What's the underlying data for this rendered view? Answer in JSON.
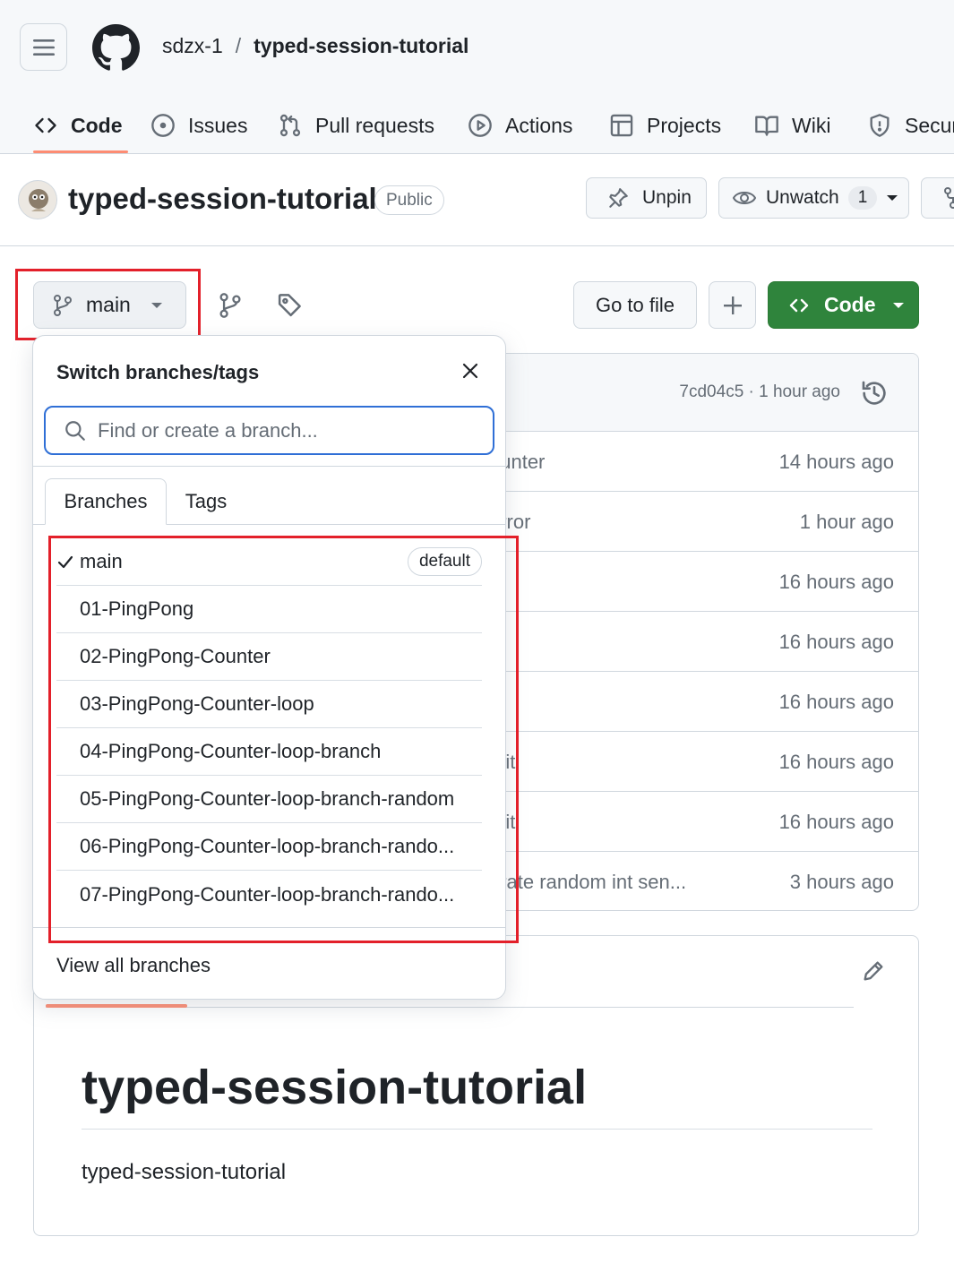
{
  "header": {
    "owner": "sdzx-1",
    "separator": "/",
    "repo": "typed-session-tutorial"
  },
  "nav_tabs": [
    {
      "label": "Code",
      "icon": "code-icon",
      "active": true
    },
    {
      "label": "Issues",
      "icon": "issue-opened-icon"
    },
    {
      "label": "Pull requests",
      "icon": "git-pull-request-icon"
    },
    {
      "label": "Actions",
      "icon": "play-icon"
    },
    {
      "label": "Projects",
      "icon": "table-icon"
    },
    {
      "label": "Wiki",
      "icon": "book-icon"
    },
    {
      "label": "Secur",
      "icon": "shield-icon"
    }
  ],
  "repo": {
    "title": "typed-session-tutorial",
    "visibility": "Public",
    "unpin_label": "Unpin",
    "unwatch_label": "Unwatch",
    "watch_count": "1"
  },
  "toolbar": {
    "branch": "main",
    "goto_file": "Go to file",
    "code_label": "Code"
  },
  "files": {
    "commit_meta": "7cd04c5 · 1 hour ago",
    "rows": [
      {
        "msg": "ounter",
        "age": "14 hours ago"
      },
      {
        "msg": "error",
        "age": "1 hour ago"
      },
      {
        "msg": "",
        "age": "16 hours ago"
      },
      {
        "msg": "",
        "age": "16 hours ago"
      },
      {
        "msg": "",
        "age": "16 hours ago"
      },
      {
        "msg": "mit",
        "age": "16 hours ago"
      },
      {
        "msg": "mit",
        "age": "16 hours ago"
      },
      {
        "msg": "erate random int sen...",
        "age": "3 hours ago"
      }
    ]
  },
  "popover": {
    "title": "Switch branches/tags",
    "search_placeholder": "Find or create a branch...",
    "tab_branches": "Branches",
    "tab_tags": "Tags",
    "default_badge": "default",
    "branches": [
      "main",
      "01-PingPong",
      "02-PingPong-Counter",
      "03-PingPong-Counter-loop",
      "04-PingPong-Counter-loop-branch",
      "05-PingPong-Counter-loop-branch-random",
      "06-PingPong-Counter-loop-branch-rando...",
      "07-PingPong-Counter-loop-branch-rando..."
    ],
    "view_all": "View all branches"
  },
  "readme": {
    "heading": "typed-session-tutorial",
    "body": "typed-session-tutorial"
  },
  "colors": {
    "accent_tab": "#fd8c73",
    "primary_green": "#2f843c",
    "highlight_red": "#e3202a",
    "focus_blue": "#2f6fd6"
  }
}
